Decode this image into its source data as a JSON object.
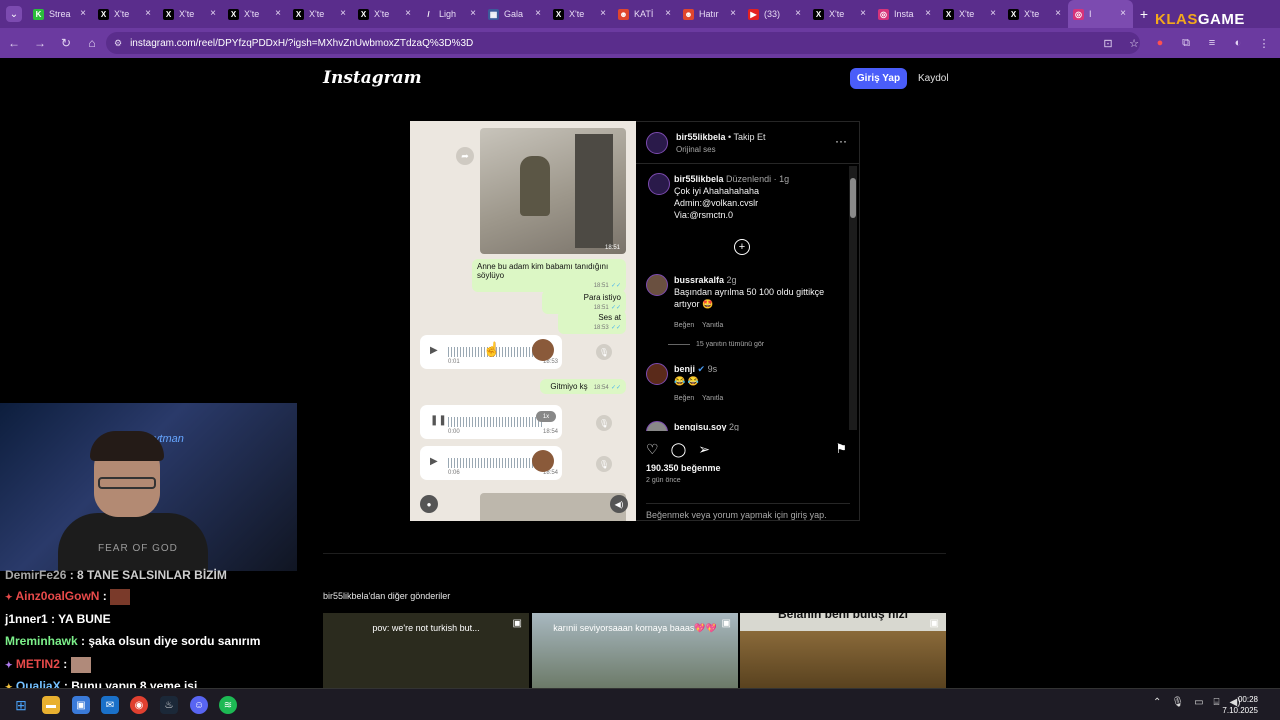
{
  "browser": {
    "tabs": [
      {
        "title": "Strea",
        "fav": "K",
        "color": "#2bbd3c"
      },
      {
        "title": "X'te",
        "fav": "X",
        "color": "#000000"
      },
      {
        "title": "X'te",
        "fav": "X",
        "color": "#000000"
      },
      {
        "title": "X'te",
        "fav": "X",
        "color": "#000000"
      },
      {
        "title": "X'te",
        "fav": "X",
        "color": "#000000"
      },
      {
        "title": "X'te",
        "fav": "X",
        "color": "#000000"
      },
      {
        "title": "Ligh",
        "fav": "/",
        "color": "#5a2d8c"
      },
      {
        "title": "Gala",
        "fav": "▦",
        "color": "#3c5a9a"
      },
      {
        "title": "X'te",
        "fav": "X",
        "color": "#000000"
      },
      {
        "title": "KATİ",
        "fav": "☻",
        "color": "#e0462d"
      },
      {
        "title": "Hatır",
        "fav": "☻",
        "color": "#e0462d"
      },
      {
        "title": "(33)",
        "fav": "▶",
        "color": "#e32020"
      },
      {
        "title": "X'te",
        "fav": "X",
        "color": "#000000"
      },
      {
        "title": "Insta",
        "fav": "◎",
        "color": "#d6337a"
      },
      {
        "title": "X'te",
        "fav": "X",
        "color": "#000000"
      },
      {
        "title": "X'te",
        "fav": "X",
        "color": "#000000"
      },
      {
        "title": "I",
        "fav": "◎",
        "color": "#d6337a"
      }
    ],
    "new_tab": "+",
    "brand_a": "KLAS",
    "brand_b": "GAME",
    "url": "instagram.com/reel/DPYfzqPDDxH/?igsh=MXhvZnUwbmoxZTdzaQ%3D%3D"
  },
  "header": {
    "logo": "Instagram",
    "login": "Giriş Yap",
    "signup": "Kaydol"
  },
  "reel": {
    "msgs": {
      "m1": "Anne bu adam kim babamı tanıdığını söylüyo",
      "m1_time": "18:51",
      "m2": "Para istiyo",
      "m2_time": "18:51",
      "m3": "Ses at",
      "m3_time": "18:53",
      "m4": "Gitmiyo kş",
      "m4_time": "18:54",
      "photo_time": "18:51"
    },
    "voices": [
      {
        "start": "0:01",
        "end": "18:53"
      },
      {
        "start": "0:00",
        "end": "18:54",
        "speed": "1x"
      },
      {
        "start": "0:06",
        "end": "18:54"
      }
    ]
  },
  "post": {
    "author": "bir55likbela",
    "follow": "• Takip Et",
    "audio": "Orijinal ses",
    "caption": {
      "user": "bir55likbela",
      "edited": "Düzenlendi · 1g",
      "line1": "Çok iyi Ahahahahaha",
      "line2": "Admin:@volkan.cvslr",
      "line3": "Via:@rsmctn.0"
    },
    "comments": [
      {
        "user": "bussrakalfa",
        "age": "2g",
        "text": "Başından ayrılma 50 100 oldu gittikçe artıyor 🤩",
        "like": "Beğen",
        "reply": "Yanıtla"
      },
      {
        "user": "benji",
        "age": "9s",
        "text": "😂 😂",
        "like": "Beğen",
        "reply": "Yanıtla"
      },
      {
        "user": "bengisu.soy",
        "age": "2g",
        "text": "",
        "like": "",
        "reply": ""
      }
    ],
    "more_replies": "15 yanıtın tümünü gör",
    "likes": "190.350 beğenme",
    "ago": "2 gün önce",
    "login_prompt": "Beğenmek veya yorum yapmak için giriş yap."
  },
  "more": {
    "title": "bir55likbela'dan diğer gönderiler",
    "thumbs": [
      {
        "caption": "pov: we're not turkish but...",
        "bg": "#2b2b1e"
      },
      {
        "caption": "karınii seviyorsaaan kornaya baaas💖💖",
        "bg": "#6c7a68"
      },
      {
        "caption": "Belanın beni buluş hızı",
        "bg": "#59421f"
      }
    ]
  },
  "stream": {
    "shirt": "FEAR OF GOD",
    "neon": "Lytman",
    "chat": [
      {
        "user": "DemirFe26",
        "msg": "8 TANE SALSINLAR BİZİM",
        "color": "#d0d0d0"
      },
      {
        "user": "Ainz0oalGowN",
        "msg": "",
        "color": "#e84a4a"
      },
      {
        "user": "j1nner1",
        "msg": "YA BUNE",
        "color": "#ffffff"
      },
      {
        "user": "Mreminhawk",
        "msg": "şaka olsun diye sordu sanırım",
        "color": "#7cf08a"
      },
      {
        "user": "METIN2",
        "msg": "",
        "color": "#e84a4a"
      },
      {
        "user": "QualiaX",
        "msg": "Bunu yapıp 8 yeme işi",
        "color": "#74c0ff"
      }
    ]
  },
  "taskbar": {
    "time": "00:28",
    "date": "7.10.2025"
  }
}
